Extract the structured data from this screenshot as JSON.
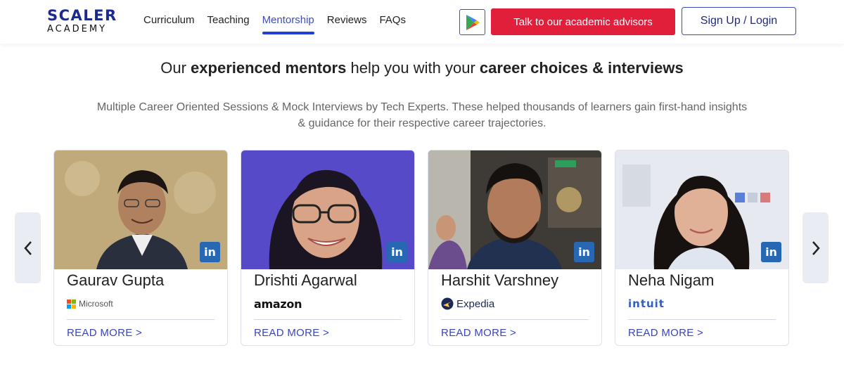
{
  "logo": {
    "top": "SCALER",
    "bottom": "ACADEMY"
  },
  "nav": {
    "items": [
      {
        "label": "Curriculum"
      },
      {
        "label": "Teaching"
      },
      {
        "label": "Mentorship"
      },
      {
        "label": "Reviews"
      },
      {
        "label": "FAQs"
      }
    ],
    "active": "Mentorship"
  },
  "header_actions": {
    "play_icon": "google-play-icon",
    "advisor_label": "Talk to our academic advisors",
    "login_label": "Sign Up / Login"
  },
  "headline": {
    "part1": "Our ",
    "bold1": "experienced mentors",
    "part2": " help you with your ",
    "bold2": "career choices & interviews"
  },
  "subtitle_line1": "Multiple Career Oriented Sessions & Mock Interviews by Tech Experts. These helped thousands of learners gain first-hand insights",
  "subtitle_line2": "& guidance for their respective career trajectories.",
  "carousel": {
    "prev_icon": "chevron-left-icon",
    "next_icon": "chevron-right-icon"
  },
  "mentors": [
    {
      "name": "Gaurav Gupta",
      "company": "Microsoft",
      "read_more": "READ MORE >",
      "linkedin": "in"
    },
    {
      "name": "Drishti Agarwal",
      "company": "amazon",
      "read_more": "READ MORE >",
      "linkedin": "in"
    },
    {
      "name": "Harshit Varshney",
      "company": "Expedia",
      "read_more": "READ MORE >",
      "linkedin": "in"
    },
    {
      "name": "Neha Nigam",
      "company": "intuit",
      "read_more": "READ MORE >",
      "linkedin": "in"
    }
  ],
  "colors": {
    "brand_blue": "#1b2a8f",
    "accent_red": "#e21f3b",
    "link_blue": "#3a46b5",
    "linkedin_blue": "#2867b2"
  }
}
